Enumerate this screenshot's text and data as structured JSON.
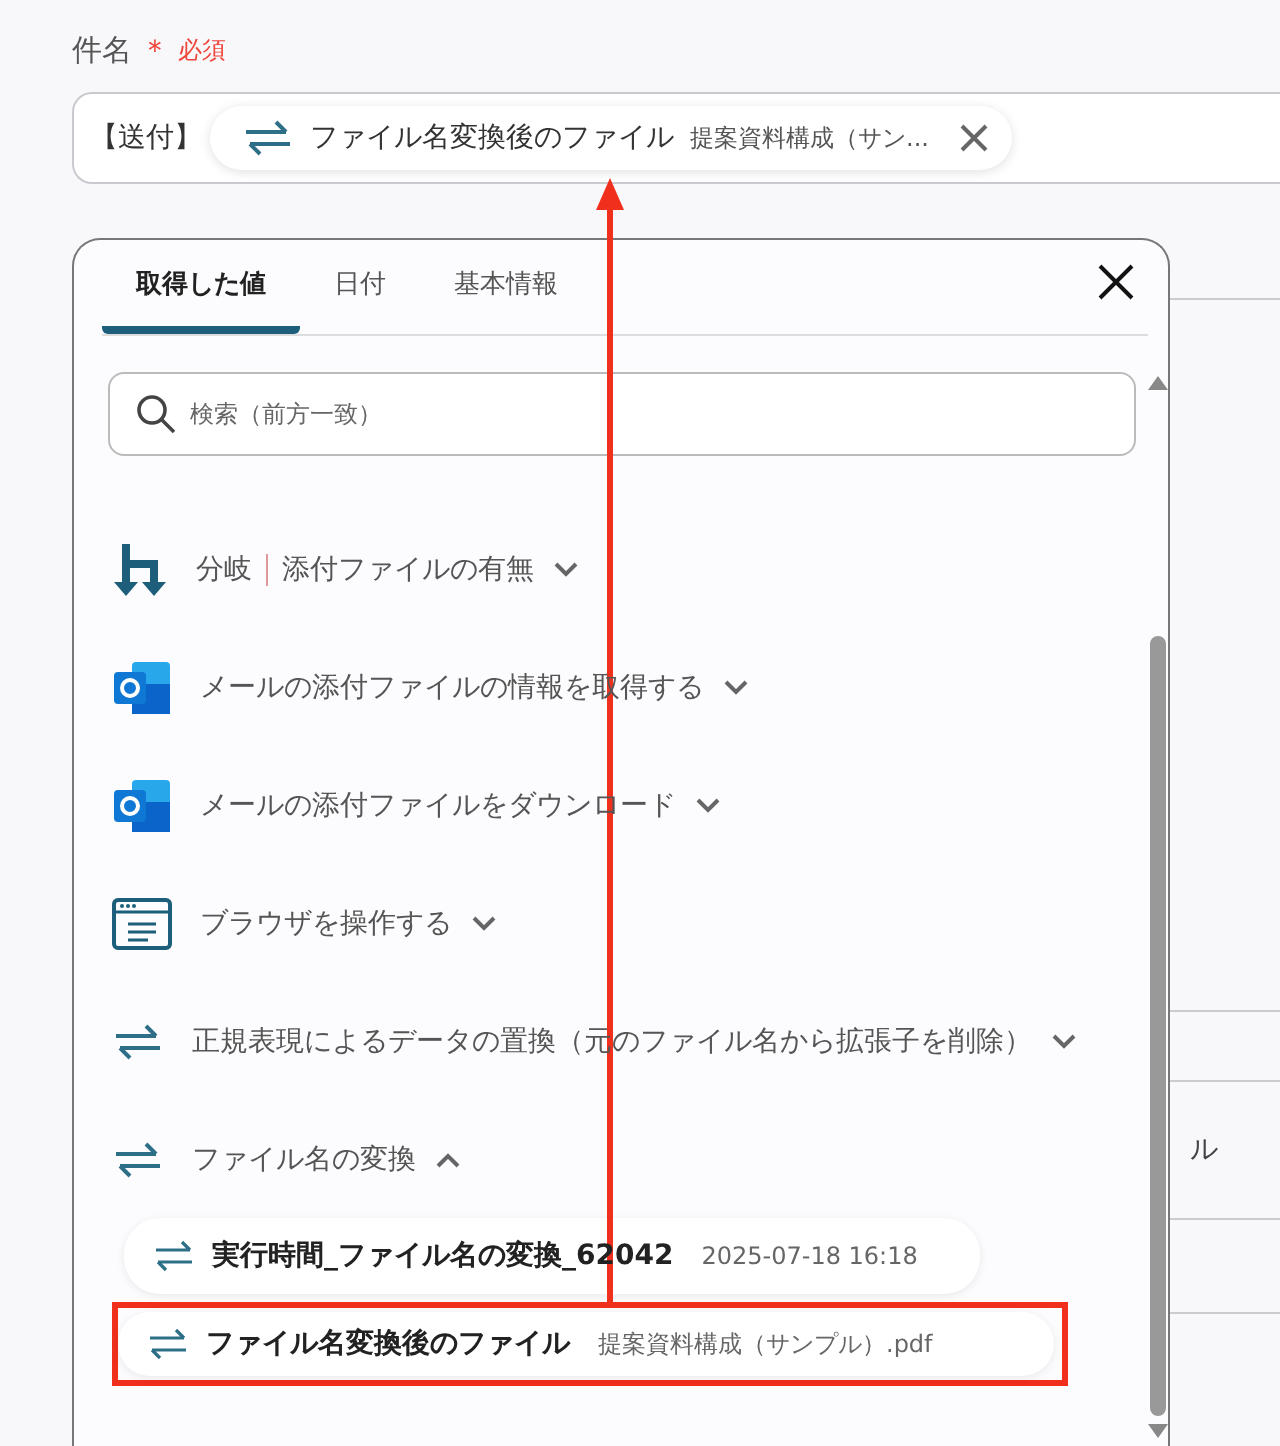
{
  "field": {
    "label": "件名",
    "required_mark": "＊",
    "required": "必須",
    "prefix": "【送付】",
    "token": {
      "name": "ファイル名変換後のファイル",
      "value": "提案資料構成（サン..."
    }
  },
  "popup": {
    "tabs": [
      {
        "label": "取得した値",
        "selected": true
      },
      {
        "label": "日付",
        "selected": false
      },
      {
        "label": "基本情報",
        "selected": false
      }
    ],
    "search": {
      "placeholder": "検索（前方一致）"
    },
    "groups": [
      {
        "kind": "branch",
        "title": "分岐",
        "subtitle": "添付ファイルの有無",
        "expanded": false
      },
      {
        "kind": "mail",
        "title": "メールの添付ファイルの情報を取得する",
        "expanded": false
      },
      {
        "kind": "mail",
        "title": "メールの添付ファイルをダウンロード",
        "expanded": false
      },
      {
        "kind": "browser",
        "title": "ブラウザを操作する",
        "expanded": false
      },
      {
        "kind": "convert",
        "title": "正規表現によるデータの置換（元のファイル名から拡張子を削除）",
        "expanded": false
      },
      {
        "kind": "convert",
        "title": "ファイル名の変換",
        "expanded": true,
        "children": [
          {
            "name": "実行時間_ファイル名の変換_62042",
            "value": "2025-07-18 16:18",
            "highlighted": false
          },
          {
            "name": "ファイル名変換後のファイル",
            "value": "提案資料構成（サンプル）.pdf",
            "highlighted": true
          }
        ]
      }
    ]
  },
  "background": {
    "fragment": "ル"
  }
}
